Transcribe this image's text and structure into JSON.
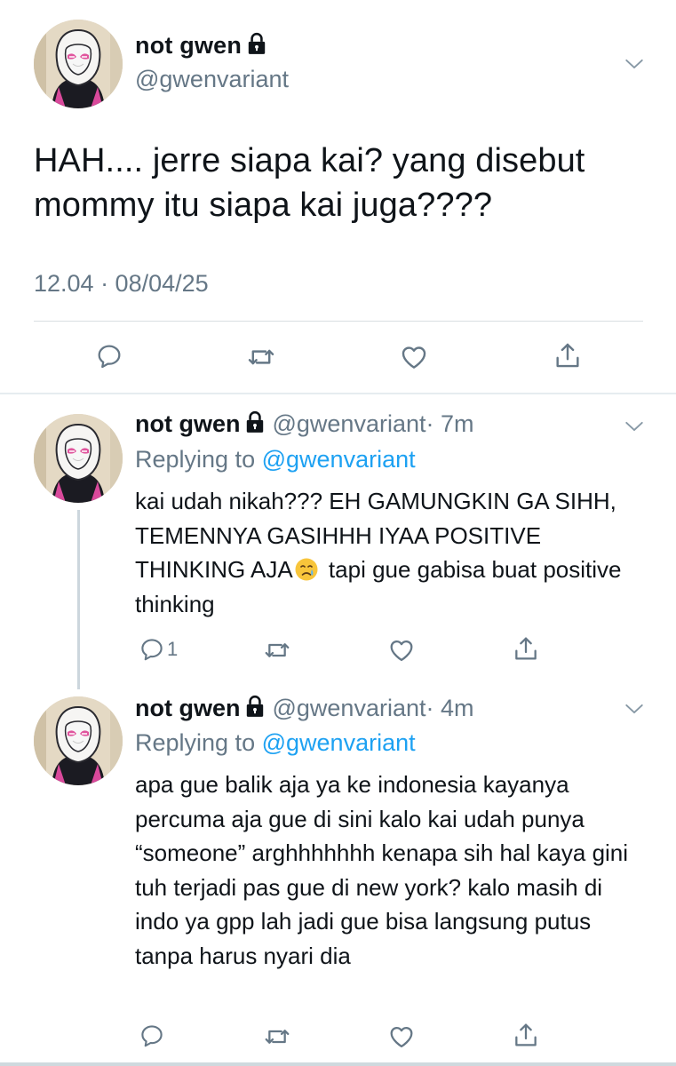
{
  "main_tweet": {
    "display_name": "not gwen",
    "handle": "@gwenvariant",
    "text": "HAH.... jerre siapa kai? yang disebut mommy itu siapa kai juga????",
    "timestamp": "12.04 · 08/04/25",
    "icons": [
      "lock-icon",
      "chevron-down-icon",
      "reply-icon",
      "retweet-icon",
      "like-icon",
      "share-icon"
    ]
  },
  "replies": [
    {
      "display_name": "not gwen",
      "handle": "@gwenvariant",
      "time": "· 7m",
      "replying_prefix": "Replying to",
      "replying_to": "@gwenvariant",
      "text_before_emoji": "kai udah nikah??? EH GAMUNGKIN GA SIHH, TEMENNYA GASIHHH IYAA POSITIVE THINKING AJA",
      "text_after_emoji": " tapi gue gabisa buat positive thinking",
      "emoji": "crying-face",
      "reply_count": "1"
    },
    {
      "display_name": "not gwen",
      "handle": "@gwenvariant",
      "time": "· 4m",
      "replying_prefix": "Replying to",
      "replying_to": "@gwenvariant",
      "text": "apa gue balik aja ya ke indonesia kayanya percuma aja gue di sini kalo kai udah punya “someone” arghhhhhhh kenapa sih hal kaya gini tuh terjadi pas gue di new york? kalo masih di indo ya gpp lah jadi gue bisa langsung putus tanpa harus nyari dia",
      "reply_count": ""
    }
  ],
  "colors": {
    "text": "#0f1419",
    "secondary": "#657786",
    "link": "#1da1f2",
    "divider": "#e6ecf0"
  }
}
